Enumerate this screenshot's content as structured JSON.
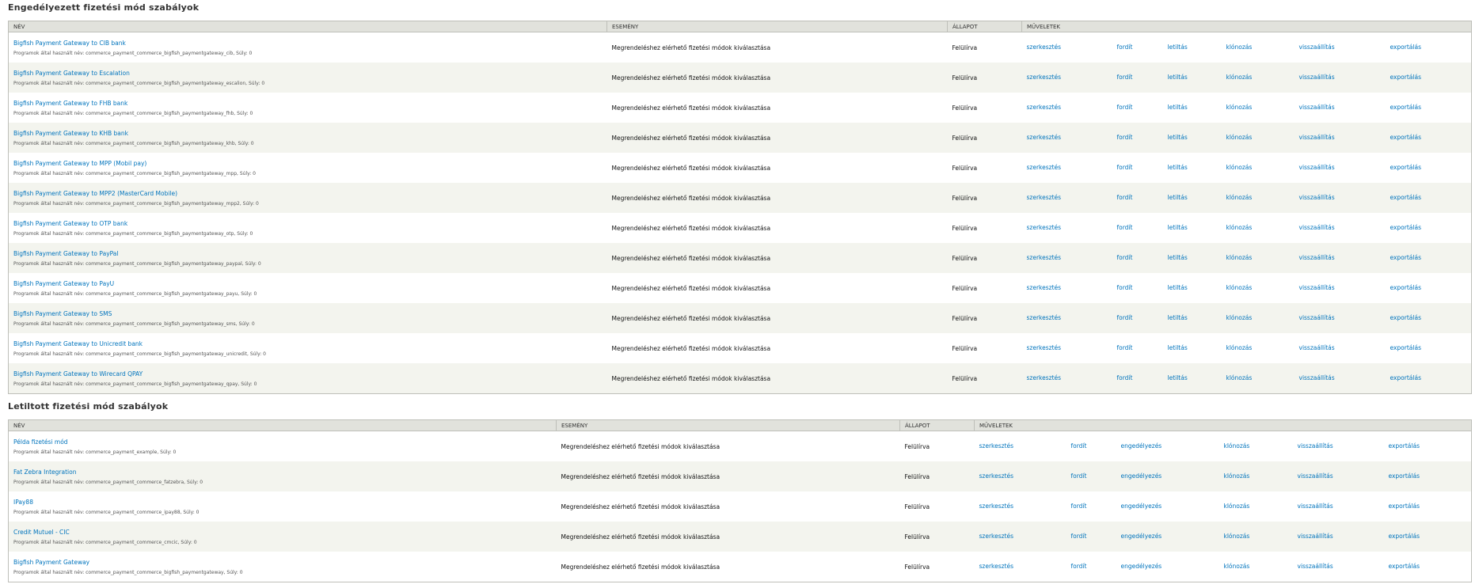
{
  "enabled": {
    "title": "Engedélyezett fizetési mód szabályok",
    "headers": [
      "NÉV",
      "ESEMÉNY",
      "ÁLLAPOT",
      "MŰVELETEK"
    ],
    "operations": [
      "szerkesztés",
      "fordít",
      "letiltás",
      "klónozás",
      "visszaállítás",
      "exportálás"
    ],
    "rows": [
      {
        "name": "Bigfish Payment Gateway to CIB bank",
        "machine": "Programok által használt név: commerce_payment_commerce_bigfish_paymentgateway_cib, Súly: 0",
        "event": "Megrendeléshez elérhető fizetési módok kiválasztása",
        "status": "Felülírva"
      },
      {
        "name": "Bigfish Payment Gateway to Escalation",
        "machine": "Programok által használt név: commerce_payment_commerce_bigfish_paymentgateway_escalion, Súly: 0",
        "event": "Megrendeléshez elérhető fizetési módok kiválasztása",
        "status": "Felülírva"
      },
      {
        "name": "Bigfish Payment Gateway to FHB bank",
        "machine": "Programok által használt név: commerce_payment_commerce_bigfish_paymentgateway_fhb, Súly: 0",
        "event": "Megrendeléshez elérhető fizetési módok kiválasztása",
        "status": "Felülírva"
      },
      {
        "name": "Bigfish Payment Gateway to KHB bank",
        "machine": "Programok által használt név: commerce_payment_commerce_bigfish_paymentgateway_khb, Súly: 0",
        "event": "Megrendeléshez elérhető fizetési módok kiválasztása",
        "status": "Felülírva"
      },
      {
        "name": "Bigfish Payment Gateway to MPP (Mobil pay)",
        "machine": "Programok által használt név: commerce_payment_commerce_bigfish_paymentgateway_mpp, Súly: 0",
        "event": "Megrendeléshez elérhető fizetési módok kiválasztása",
        "status": "Felülírva"
      },
      {
        "name": "Bigfish Payment Gateway to MPP2 (MasterCard Mobile)",
        "machine": "Programok által használt név: commerce_payment_commerce_bigfish_paymentgateway_mpp2, Súly: 0",
        "event": "Megrendeléshez elérhető fizetési módok kiválasztása",
        "status": "Felülírva"
      },
      {
        "name": "Bigfish Payment Gateway to OTP bank",
        "machine": "Programok által használt név: commerce_payment_commerce_bigfish_paymentgateway_otp, Súly: 0",
        "event": "Megrendeléshez elérhető fizetési módok kiválasztása",
        "status": "Felülírva"
      },
      {
        "name": "Bigfish Payment Gateway to PayPal",
        "machine": "Programok által használt név: commerce_payment_commerce_bigfish_paymentgateway_paypal, Súly: 0",
        "event": "Megrendeléshez elérhető fizetési módok kiválasztása",
        "status": "Felülírva"
      },
      {
        "name": "Bigfish Payment Gateway to PayU",
        "machine": "Programok által használt név: commerce_payment_commerce_bigfish_paymentgateway_payu, Súly: 0",
        "event": "Megrendeléshez elérhető fizetési módok kiválasztása",
        "status": "Felülírva"
      },
      {
        "name": "Bigfish Payment Gateway to SMS",
        "machine": "Programok által használt név: commerce_payment_commerce_bigfish_paymentgateway_sms, Súly: 0",
        "event": "Megrendeléshez elérhető fizetési módok kiválasztása",
        "status": "Felülírva"
      },
      {
        "name": "Bigfish Payment Gateway to Unicredit bank",
        "machine": "Programok által használt név: commerce_payment_commerce_bigfish_paymentgateway_unicredit, Súly: 0",
        "event": "Megrendeléshez elérhető fizetési módok kiválasztása",
        "status": "Felülírva"
      },
      {
        "name": "Bigfish Payment Gateway to Wirecard QPAY",
        "machine": "Programok által használt név: commerce_payment_commerce_bigfish_paymentgateway_qpay, Súly: 0",
        "event": "Megrendeléshez elérhető fizetési módok kiválasztása",
        "status": "Felülírva"
      }
    ]
  },
  "disabled": {
    "title": "Letiltott fizetési mód szabályok",
    "headers": [
      "NÉV",
      "ESEMÉNY",
      "ÁLLAPOT",
      "MŰVELETEK"
    ],
    "operations": [
      "szerkesztés",
      "fordít",
      "engedélyezés",
      "klónozás",
      "visszaállítás",
      "exportálás"
    ],
    "rows": [
      {
        "name": "Példa fizetési mód",
        "machine": "Programok által használt név: commerce_payment_example, Súly: 0",
        "event": "Megrendeléshez elérhető fizetési módok kiválasztása",
        "status": "Felülírva"
      },
      {
        "name": "Fat Zebra Integration",
        "machine": "Programok által használt név: commerce_payment_commerce_fatzebra, Súly: 0",
        "event": "Megrendeléshez elérhető fizetési módok kiválasztása",
        "status": "Felülírva"
      },
      {
        "name": "IPay88",
        "machine": "Programok által használt név: commerce_payment_commerce_ipay88, Súly: 0",
        "event": "Megrendeléshez elérhető fizetési módok kiválasztása",
        "status": "Felülírva"
      },
      {
        "name": "Credit Mutuel - CIC",
        "machine": "Programok által használt név: commerce_payment_commerce_cmcic, Súly: 0",
        "event": "Megrendeléshez elérhető fizetési módok kiválasztása",
        "status": "Felülírva"
      },
      {
        "name": "Bigfish Payment Gateway",
        "machine": "Programok által használt név: commerce_payment_commerce_bigfish_paymentgateway, Súly: 0",
        "event": "Megrendeléshez elérhető fizetési módok kiválasztása",
        "status": "Felülírva"
      }
    ]
  },
  "colors": {
    "link": "#0074bd",
    "header_bg": "#e1e2dc",
    "even_row_bg": "#f3f4ee",
    "border": "#bebfb9"
  }
}
